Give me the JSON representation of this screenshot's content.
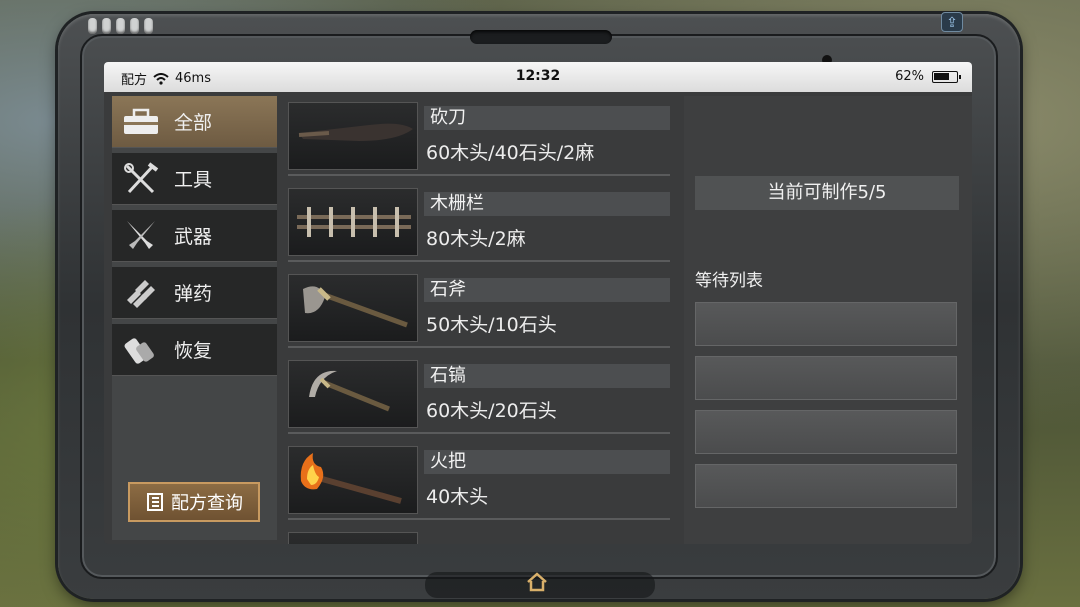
{
  "statusbar": {
    "carrier": "配方",
    "ping": "46ms",
    "time": "12:32",
    "battery": "62%"
  },
  "categories": [
    {
      "label": "全部",
      "icon": "toolbox-icon",
      "active": true
    },
    {
      "label": "工具",
      "icon": "tools-icon",
      "active": false
    },
    {
      "label": "武器",
      "icon": "crossed-knives-icon",
      "active": false
    },
    {
      "label": "弹药",
      "icon": "bullets-icon",
      "active": false
    },
    {
      "label": "恢复",
      "icon": "bandage-icon",
      "active": false
    }
  ],
  "recipe_button": {
    "label": "配方查询",
    "icon": "book-icon"
  },
  "items": [
    {
      "name": "砍刀",
      "cost": "60木头/40石头/2麻",
      "icon": "machete-icon"
    },
    {
      "name": "木栅栏",
      "cost": "80木头/2麻",
      "icon": "wooden-fence-icon"
    },
    {
      "name": "石斧",
      "cost": "50木头/10石头",
      "icon": "stone-axe-icon"
    },
    {
      "name": "石镐",
      "cost": "60木头/20石头",
      "icon": "stone-pickaxe-icon"
    },
    {
      "name": "火把",
      "cost": "40木头",
      "icon": "torch-icon"
    }
  ],
  "queue": {
    "can_make": "当前可制作5/5",
    "wait_label": "等待列表",
    "slot_count": 4
  }
}
